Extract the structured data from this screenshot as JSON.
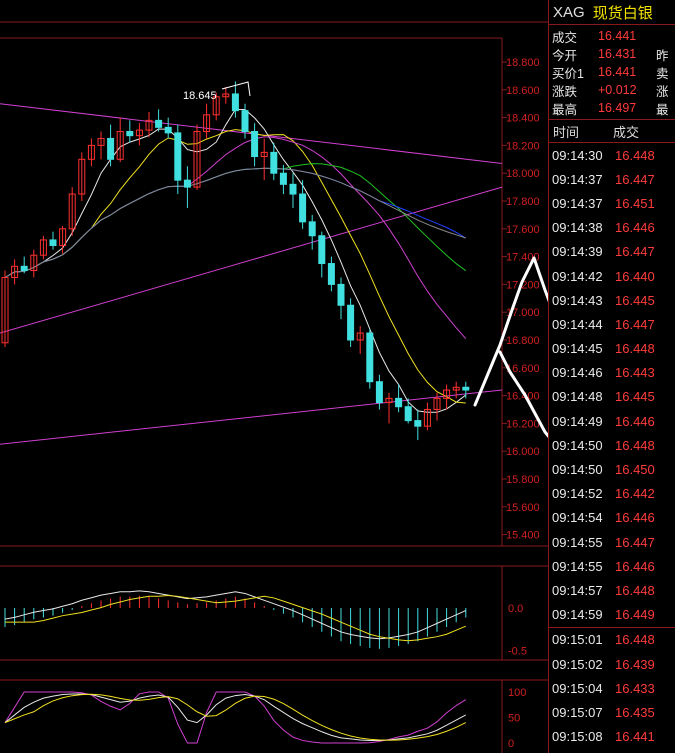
{
  "chart_data": [
    {
      "type": "candlestick",
      "ylim": [
        15.35,
        18.95
      ],
      "y_ticks": [
        "18.800",
        "18.600",
        "18.400",
        "18.200",
        "18.000",
        "17.800",
        "17.600",
        "17.400",
        "17.200",
        "17.000",
        "16.800",
        "16.600",
        "16.400",
        "16.200",
        "16.000",
        "15.800",
        "15.600",
        "15.400"
      ],
      "annotations": [
        {
          "text": "18.645"
        }
      ],
      "candles": [
        {
          "o": 16.78,
          "h": 17.3,
          "l": 16.75,
          "c": 17.25
        },
        {
          "o": 17.25,
          "h": 17.38,
          "l": 17.2,
          "c": 17.33
        },
        {
          "o": 17.33,
          "h": 17.4,
          "l": 17.28,
          "c": 17.3
        },
        {
          "o": 17.3,
          "h": 17.45,
          "l": 17.25,
          "c": 17.41
        },
        {
          "o": 17.41,
          "h": 17.55,
          "l": 17.38,
          "c": 17.52
        },
        {
          "o": 17.52,
          "h": 17.58,
          "l": 17.45,
          "c": 17.48
        },
        {
          "o": 17.48,
          "h": 17.62,
          "l": 17.42,
          "c": 17.6
        },
        {
          "o": 17.6,
          "h": 17.9,
          "l": 17.55,
          "c": 17.85
        },
        {
          "o": 17.85,
          "h": 18.15,
          "l": 17.8,
          "c": 18.1
        },
        {
          "o": 18.1,
          "h": 18.25,
          "l": 18.05,
          "c": 18.2
        },
        {
          "o": 18.2,
          "h": 18.3,
          "l": 18.1,
          "c": 18.25
        },
        {
          "o": 18.25,
          "h": 18.35,
          "l": 18.05,
          "c": 18.1
        },
        {
          "o": 18.1,
          "h": 18.4,
          "l": 18.08,
          "c": 18.3
        },
        {
          "o": 18.3,
          "h": 18.38,
          "l": 18.22,
          "c": 18.27
        },
        {
          "o": 18.27,
          "h": 18.36,
          "l": 18.2,
          "c": 18.31
        },
        {
          "o": 18.31,
          "h": 18.44,
          "l": 18.26,
          "c": 18.38
        },
        {
          "o": 18.38,
          "h": 18.46,
          "l": 18.3,
          "c": 18.33
        },
        {
          "o": 18.33,
          "h": 18.4,
          "l": 18.25,
          "c": 18.29
        },
        {
          "o": 18.29,
          "h": 18.35,
          "l": 17.85,
          "c": 17.95
        },
        {
          "o": 17.95,
          "h": 18.05,
          "l": 17.75,
          "c": 17.9
        },
        {
          "o": 17.9,
          "h": 18.35,
          "l": 17.88,
          "c": 18.3
        },
        {
          "o": 18.3,
          "h": 18.5,
          "l": 18.25,
          "c": 18.42
        },
        {
          "o": 18.42,
          "h": 18.58,
          "l": 18.38,
          "c": 18.55
        },
        {
          "o": 18.55,
          "h": 18.62,
          "l": 18.5,
          "c": 18.57
        },
        {
          "o": 18.57,
          "h": 18.66,
          "l": 18.4,
          "c": 18.45
        },
        {
          "o": 18.45,
          "h": 18.5,
          "l": 18.25,
          "c": 18.3
        },
        {
          "o": 18.3,
          "h": 18.36,
          "l": 18.05,
          "c": 18.12
        },
        {
          "o": 18.12,
          "h": 18.25,
          "l": 17.95,
          "c": 18.15
        },
        {
          "o": 18.15,
          "h": 18.22,
          "l": 17.95,
          "c": 18.0
        },
        {
          "o": 18.0,
          "h": 18.06,
          "l": 17.85,
          "c": 17.92
        },
        {
          "o": 17.92,
          "h": 18.0,
          "l": 17.75,
          "c": 17.85
        },
        {
          "o": 17.85,
          "h": 17.95,
          "l": 17.6,
          "c": 17.65
        },
        {
          "o": 17.65,
          "h": 17.7,
          "l": 17.45,
          "c": 17.55
        },
        {
          "o": 17.55,
          "h": 17.58,
          "l": 17.25,
          "c": 17.35
        },
        {
          "o": 17.35,
          "h": 17.4,
          "l": 17.15,
          "c": 17.2
        },
        {
          "o": 17.2,
          "h": 17.25,
          "l": 16.95,
          "c": 17.05
        },
        {
          "o": 17.05,
          "h": 17.1,
          "l": 16.75,
          "c": 16.8
        },
        {
          "o": 16.8,
          "h": 16.9,
          "l": 16.7,
          "c": 16.85
        },
        {
          "o": 16.85,
          "h": 16.88,
          "l": 16.45,
          "c": 16.5
        },
        {
          "o": 16.5,
          "h": 16.55,
          "l": 16.3,
          "c": 16.35
        },
        {
          "o": 16.35,
          "h": 16.42,
          "l": 16.2,
          "c": 16.38
        },
        {
          "o": 16.38,
          "h": 16.48,
          "l": 16.28,
          "c": 16.32
        },
        {
          "o": 16.32,
          "h": 16.38,
          "l": 16.2,
          "c": 16.22
        },
        {
          "o": 16.22,
          "h": 16.3,
          "l": 16.08,
          "c": 16.18
        },
        {
          "o": 16.18,
          "h": 16.35,
          "l": 16.15,
          "c": 16.3
        },
        {
          "o": 16.3,
          "h": 16.42,
          "l": 16.22,
          "c": 16.38
        },
        {
          "o": 16.38,
          "h": 16.48,
          "l": 16.3,
          "c": 16.44
        },
        {
          "o": 16.44,
          "h": 16.5,
          "l": 16.38,
          "c": 16.46
        },
        {
          "o": 16.46,
          "h": 16.5,
          "l": 16.38,
          "c": 16.44
        }
      ]
    },
    {
      "type": "bar",
      "y_ticks": [
        "0.0",
        "-0.5"
      ],
      "values": [
        -0.2,
        -0.18,
        -0.15,
        -0.12,
        -0.1,
        -0.08,
        -0.05,
        -0.02,
        0.02,
        0.05,
        0.08,
        0.1,
        0.12,
        0.12,
        0.13,
        0.12,
        0.1,
        0.08,
        0.06,
        0.04,
        0.05,
        0.06,
        0.08,
        0.1,
        0.12,
        0.1,
        0.06,
        0.02,
        -0.02,
        -0.06,
        -0.1,
        -0.15,
        -0.2,
        -0.25,
        -0.3,
        -0.35,
        -0.38,
        -0.4,
        -0.42,
        -0.43,
        -0.42,
        -0.4,
        -0.38,
        -0.35,
        -0.3,
        -0.25,
        -0.2,
        -0.15,
        -0.1
      ]
    },
    {
      "type": "line",
      "y_ticks": [
        "100",
        "50",
        "0"
      ]
    }
  ],
  "panel": {
    "symbol": "XAG",
    "name": "现货白银",
    "quote": [
      {
        "label": "成交",
        "value": "16.441",
        "extra": ""
      },
      {
        "label": "今开",
        "value": "16.431",
        "extra": "昨"
      },
      {
        "label": "买价1",
        "value": "16.441",
        "extra": "卖"
      },
      {
        "label": "涨跌",
        "value": "+0.012",
        "extra": "涨"
      },
      {
        "label": "最高",
        "value": "16.497",
        "extra": "最"
      }
    ],
    "trades_header": {
      "time": "时间",
      "price": "成交"
    },
    "trades": [
      {
        "time": "09:14:30",
        "price": "16.448"
      },
      {
        "time": "09:14:37",
        "price": "16.447"
      },
      {
        "time": "09:14:37",
        "price": "16.451"
      },
      {
        "time": "09:14:38",
        "price": "16.446"
      },
      {
        "time": "09:14:39",
        "price": "16.447"
      },
      {
        "time": "09:14:42",
        "price": "16.440"
      },
      {
        "time": "09:14:43",
        "price": "16.445"
      },
      {
        "time": "09:14:44",
        "price": "16.447"
      },
      {
        "time": "09:14:45",
        "price": "16.448"
      },
      {
        "time": "09:14:46",
        "price": "16.443"
      },
      {
        "time": "09:14:48",
        "price": "16.445"
      },
      {
        "time": "09:14:49",
        "price": "16.446"
      },
      {
        "time": "09:14:50",
        "price": "16.448"
      },
      {
        "time": "09:14:50",
        "price": "16.450"
      },
      {
        "time": "09:14:52",
        "price": "16.442"
      },
      {
        "time": "09:14:54",
        "price": "16.446"
      },
      {
        "time": "09:14:55",
        "price": "16.447"
      },
      {
        "time": "09:14:55",
        "price": "16.446"
      },
      {
        "time": "09:14:57",
        "price": "16.448"
      },
      {
        "time": "09:14:59",
        "price": "16.449"
      },
      {
        "time": "09:15:01",
        "price": "16.448"
      },
      {
        "time": "09:15:02",
        "price": "16.439"
      },
      {
        "time": "09:15:04",
        "price": "16.433"
      },
      {
        "time": "09:15:07",
        "price": "16.435"
      },
      {
        "time": "09:15:08",
        "price": "16.441"
      }
    ]
  }
}
